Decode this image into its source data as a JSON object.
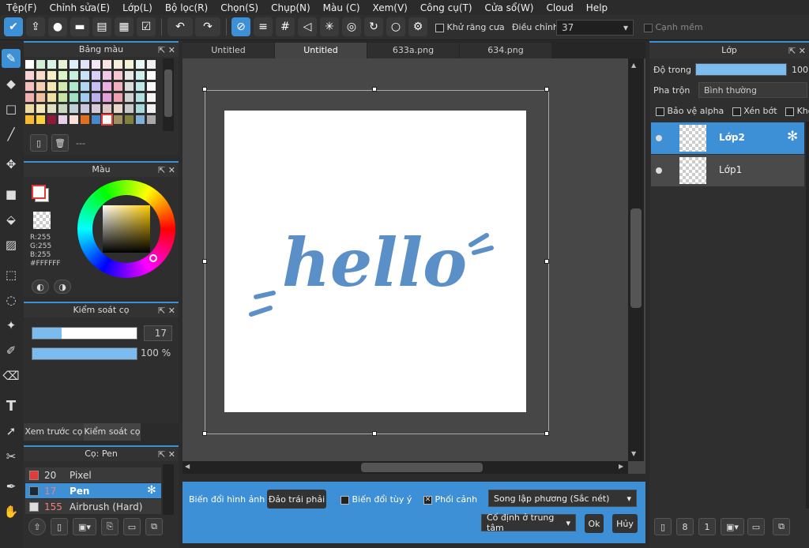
{
  "menu": [
    "Tệp(F)",
    "Chỉnh sửa(E)",
    "Lớp(L)",
    "Bộ lọc(R)",
    "Chọn(S)",
    "Chụp(N)",
    "Màu (C)",
    "Xem(V)",
    "Công cụ(T)",
    "Cửa sổ(W)",
    "Cloud",
    "Help"
  ],
  "toolbar": {
    "antialias_label": "Khử răng cưa",
    "adjust_label": "Điều chỉnh",
    "adjust_value": "37",
    "soft_edge_label": "Cạnh mềm"
  },
  "palette_panel": {
    "title": "Bảng màu",
    "footer_text": "---"
  },
  "color_panel": {
    "title": "Màu",
    "r": "R:255",
    "g": "G:255",
    "b": "B:255",
    "hex": "#FFFFFF"
  },
  "brush_control": {
    "title": "Kiểm soát cọ",
    "size": "17",
    "opacity": "100 %",
    "size_fraction": 0.28,
    "opacity_fraction": 1.0
  },
  "left_tabs": {
    "preview": "Xem trước cọ",
    "brush_control": "Kiểm soát cọ"
  },
  "brush_panel": {
    "title": "Cọ: Pen",
    "items": [
      {
        "size": "20",
        "name": "Pixel",
        "color": "#e53935"
      },
      {
        "size": "17",
        "name": "Pen",
        "color": "#1a2a3a"
      },
      {
        "size": "155",
        "name": "Airbrush (Hard)",
        "color": "#dddddd"
      }
    ]
  },
  "tabs": [
    "Untitled",
    "Untitled",
    "633a.png",
    "634.png"
  ],
  "canvas_text": "hello",
  "transform": {
    "label": "Biến đổi hình ảnh",
    "flip_button": "Đảo trái phải",
    "free_transform": "Biến đổi tùy ý",
    "perspective": "Phối cảnh",
    "interpolation": "Song lập phương (Sắc nét)",
    "anchor": "Cố định ở trung tâm",
    "ok": "Ok",
    "cancel": "Hủy"
  },
  "layer_panel": {
    "title": "Lớp",
    "opacity_label": "Độ trong",
    "opacity_value": "100",
    "blend_label": "Pha trộn",
    "blend_value": "Bình thường",
    "protect_alpha": "Bảo vệ alpha",
    "clipping": "Xén bớt",
    "lock": "Khó",
    "layers": [
      "Lớp2",
      "Lớp1"
    ]
  },
  "colors": {
    "accent": "#3d8fd6",
    "ink": "#5b8fc7"
  }
}
